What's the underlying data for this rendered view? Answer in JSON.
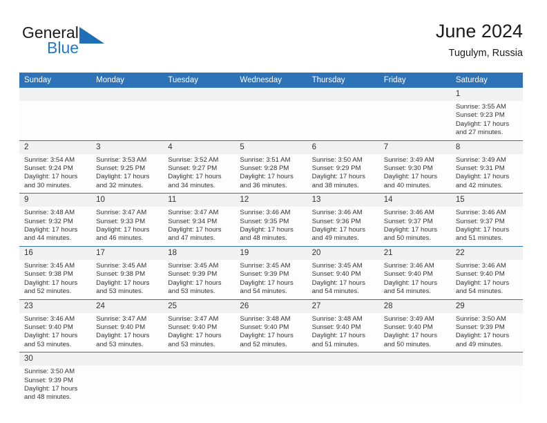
{
  "brand": {
    "name_part1": "General",
    "name_part2": "Blue",
    "flag_icon": "triangle-flag-icon",
    "color_blue": "#2277c8",
    "color_dark": "#1a1a1a"
  },
  "header": {
    "title": "June 2024",
    "subtitle": "Tugulym, Russia",
    "accent_color": "#2e72b8"
  },
  "weekdays": [
    "Sunday",
    "Monday",
    "Tuesday",
    "Wednesday",
    "Thursday",
    "Friday",
    "Saturday"
  ],
  "labels": {
    "sunrise_prefix": "Sunrise:",
    "sunset_prefix": "Sunset:",
    "daylight_prefix": "Daylight:"
  },
  "weeks": [
    [
      {
        "blank": true
      },
      {
        "blank": true
      },
      {
        "blank": true
      },
      {
        "blank": true
      },
      {
        "blank": true
      },
      {
        "blank": true
      },
      {
        "day": "1",
        "sunrise": "Sunrise: 3:55 AM",
        "sunset": "Sunset: 9:23 PM",
        "daylight_l1": "Daylight: 17 hours",
        "daylight_l2": "and 27 minutes."
      }
    ],
    [
      {
        "day": "2",
        "sunrise": "Sunrise: 3:54 AM",
        "sunset": "Sunset: 9:24 PM",
        "daylight_l1": "Daylight: 17 hours",
        "daylight_l2": "and 30 minutes."
      },
      {
        "day": "3",
        "sunrise": "Sunrise: 3:53 AM",
        "sunset": "Sunset: 9:25 PM",
        "daylight_l1": "Daylight: 17 hours",
        "daylight_l2": "and 32 minutes."
      },
      {
        "day": "4",
        "sunrise": "Sunrise: 3:52 AM",
        "sunset": "Sunset: 9:27 PM",
        "daylight_l1": "Daylight: 17 hours",
        "daylight_l2": "and 34 minutes."
      },
      {
        "day": "5",
        "sunrise": "Sunrise: 3:51 AM",
        "sunset": "Sunset: 9:28 PM",
        "daylight_l1": "Daylight: 17 hours",
        "daylight_l2": "and 36 minutes."
      },
      {
        "day": "6",
        "sunrise": "Sunrise: 3:50 AM",
        "sunset": "Sunset: 9:29 PM",
        "daylight_l1": "Daylight: 17 hours",
        "daylight_l2": "and 38 minutes."
      },
      {
        "day": "7",
        "sunrise": "Sunrise: 3:49 AM",
        "sunset": "Sunset: 9:30 PM",
        "daylight_l1": "Daylight: 17 hours",
        "daylight_l2": "and 40 minutes."
      },
      {
        "day": "8",
        "sunrise": "Sunrise: 3:49 AM",
        "sunset": "Sunset: 9:31 PM",
        "daylight_l1": "Daylight: 17 hours",
        "daylight_l2": "and 42 minutes."
      }
    ],
    [
      {
        "day": "9",
        "sunrise": "Sunrise: 3:48 AM",
        "sunset": "Sunset: 9:32 PM",
        "daylight_l1": "Daylight: 17 hours",
        "daylight_l2": "and 44 minutes."
      },
      {
        "day": "10",
        "sunrise": "Sunrise: 3:47 AM",
        "sunset": "Sunset: 9:33 PM",
        "daylight_l1": "Daylight: 17 hours",
        "daylight_l2": "and 46 minutes."
      },
      {
        "day": "11",
        "sunrise": "Sunrise: 3:47 AM",
        "sunset": "Sunset: 9:34 PM",
        "daylight_l1": "Daylight: 17 hours",
        "daylight_l2": "and 47 minutes."
      },
      {
        "day": "12",
        "sunrise": "Sunrise: 3:46 AM",
        "sunset": "Sunset: 9:35 PM",
        "daylight_l1": "Daylight: 17 hours",
        "daylight_l2": "and 48 minutes."
      },
      {
        "day": "13",
        "sunrise": "Sunrise: 3:46 AM",
        "sunset": "Sunset: 9:36 PM",
        "daylight_l1": "Daylight: 17 hours",
        "daylight_l2": "and 49 minutes."
      },
      {
        "day": "14",
        "sunrise": "Sunrise: 3:46 AM",
        "sunset": "Sunset: 9:37 PM",
        "daylight_l1": "Daylight: 17 hours",
        "daylight_l2": "and 50 minutes."
      },
      {
        "day": "15",
        "sunrise": "Sunrise: 3:46 AM",
        "sunset": "Sunset: 9:37 PM",
        "daylight_l1": "Daylight: 17 hours",
        "daylight_l2": "and 51 minutes."
      }
    ],
    [
      {
        "day": "16",
        "sunrise": "Sunrise: 3:45 AM",
        "sunset": "Sunset: 9:38 PM",
        "daylight_l1": "Daylight: 17 hours",
        "daylight_l2": "and 52 minutes."
      },
      {
        "day": "17",
        "sunrise": "Sunrise: 3:45 AM",
        "sunset": "Sunset: 9:38 PM",
        "daylight_l1": "Daylight: 17 hours",
        "daylight_l2": "and 53 minutes."
      },
      {
        "day": "18",
        "sunrise": "Sunrise: 3:45 AM",
        "sunset": "Sunset: 9:39 PM",
        "daylight_l1": "Daylight: 17 hours",
        "daylight_l2": "and 53 minutes."
      },
      {
        "day": "19",
        "sunrise": "Sunrise: 3:45 AM",
        "sunset": "Sunset: 9:39 PM",
        "daylight_l1": "Daylight: 17 hours",
        "daylight_l2": "and 54 minutes."
      },
      {
        "day": "20",
        "sunrise": "Sunrise: 3:45 AM",
        "sunset": "Sunset: 9:40 PM",
        "daylight_l1": "Daylight: 17 hours",
        "daylight_l2": "and 54 minutes."
      },
      {
        "day": "21",
        "sunrise": "Sunrise: 3:46 AM",
        "sunset": "Sunset: 9:40 PM",
        "daylight_l1": "Daylight: 17 hours",
        "daylight_l2": "and 54 minutes."
      },
      {
        "day": "22",
        "sunrise": "Sunrise: 3:46 AM",
        "sunset": "Sunset: 9:40 PM",
        "daylight_l1": "Daylight: 17 hours",
        "daylight_l2": "and 54 minutes."
      }
    ],
    [
      {
        "day": "23",
        "sunrise": "Sunrise: 3:46 AM",
        "sunset": "Sunset: 9:40 PM",
        "daylight_l1": "Daylight: 17 hours",
        "daylight_l2": "and 53 minutes."
      },
      {
        "day": "24",
        "sunrise": "Sunrise: 3:47 AM",
        "sunset": "Sunset: 9:40 PM",
        "daylight_l1": "Daylight: 17 hours",
        "daylight_l2": "and 53 minutes."
      },
      {
        "day": "25",
        "sunrise": "Sunrise: 3:47 AM",
        "sunset": "Sunset: 9:40 PM",
        "daylight_l1": "Daylight: 17 hours",
        "daylight_l2": "and 53 minutes."
      },
      {
        "day": "26",
        "sunrise": "Sunrise: 3:48 AM",
        "sunset": "Sunset: 9:40 PM",
        "daylight_l1": "Daylight: 17 hours",
        "daylight_l2": "and 52 minutes."
      },
      {
        "day": "27",
        "sunrise": "Sunrise: 3:48 AM",
        "sunset": "Sunset: 9:40 PM",
        "daylight_l1": "Daylight: 17 hours",
        "daylight_l2": "and 51 minutes."
      },
      {
        "day": "28",
        "sunrise": "Sunrise: 3:49 AM",
        "sunset": "Sunset: 9:40 PM",
        "daylight_l1": "Daylight: 17 hours",
        "daylight_l2": "and 50 minutes."
      },
      {
        "day": "29",
        "sunrise": "Sunrise: 3:50 AM",
        "sunset": "Sunset: 9:39 PM",
        "daylight_l1": "Daylight: 17 hours",
        "daylight_l2": "and 49 minutes."
      }
    ],
    [
      {
        "day": "30",
        "sunrise": "Sunrise: 3:50 AM",
        "sunset": "Sunset: 9:39 PM",
        "daylight_l1": "Daylight: 17 hours",
        "daylight_l2": "and 48 minutes."
      },
      {
        "blank": true
      },
      {
        "blank": true
      },
      {
        "blank": true
      },
      {
        "blank": true
      },
      {
        "blank": true
      },
      {
        "blank": true
      }
    ]
  ]
}
